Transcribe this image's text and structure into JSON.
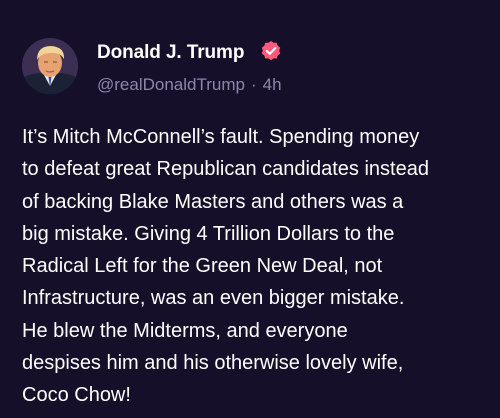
{
  "author": {
    "display_name": "Donald J. Trump",
    "handle": "@realDonaldTrump",
    "verified_icon": "verified-check-icon",
    "avatar": "profile-photo"
  },
  "meta": {
    "separator": "·",
    "time_ago": "4h"
  },
  "post": {
    "text": "It’s Mitch McConnell’s fault. Spending money\nto defeat great Republican candidates instead\nof backing Blake Masters and others was a\nbig mistake. Giving 4 Trillion Dollars to the\nRadical Left for the Green New Deal, not\nInfrastructure, was an even bigger mistake.\nHe blew the Midterms, and everyone\ndespises him and his otherwise lovely wife,\nCoco Chow!"
  },
  "colors": {
    "background": "#150f2a",
    "text": "#ffffff",
    "muted_text": "#8d87a8",
    "badge": "#ff5a7a"
  }
}
